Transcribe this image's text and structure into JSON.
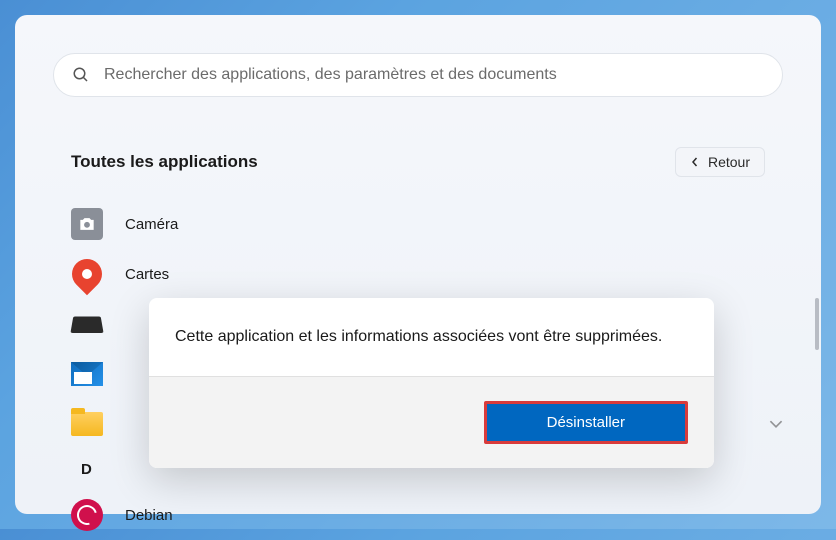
{
  "search": {
    "placeholder": "Rechercher des applications, des paramètres et des documents"
  },
  "header": {
    "title": "Toutes les applications",
    "back_label": "Retour"
  },
  "apps": {
    "camera": "Caméra",
    "maps": "Cartes",
    "letter_d": "D",
    "debian": "Debian"
  },
  "dialog": {
    "message": "Cette application et les informations associées vont être supprimées.",
    "button": "Désinstaller"
  }
}
